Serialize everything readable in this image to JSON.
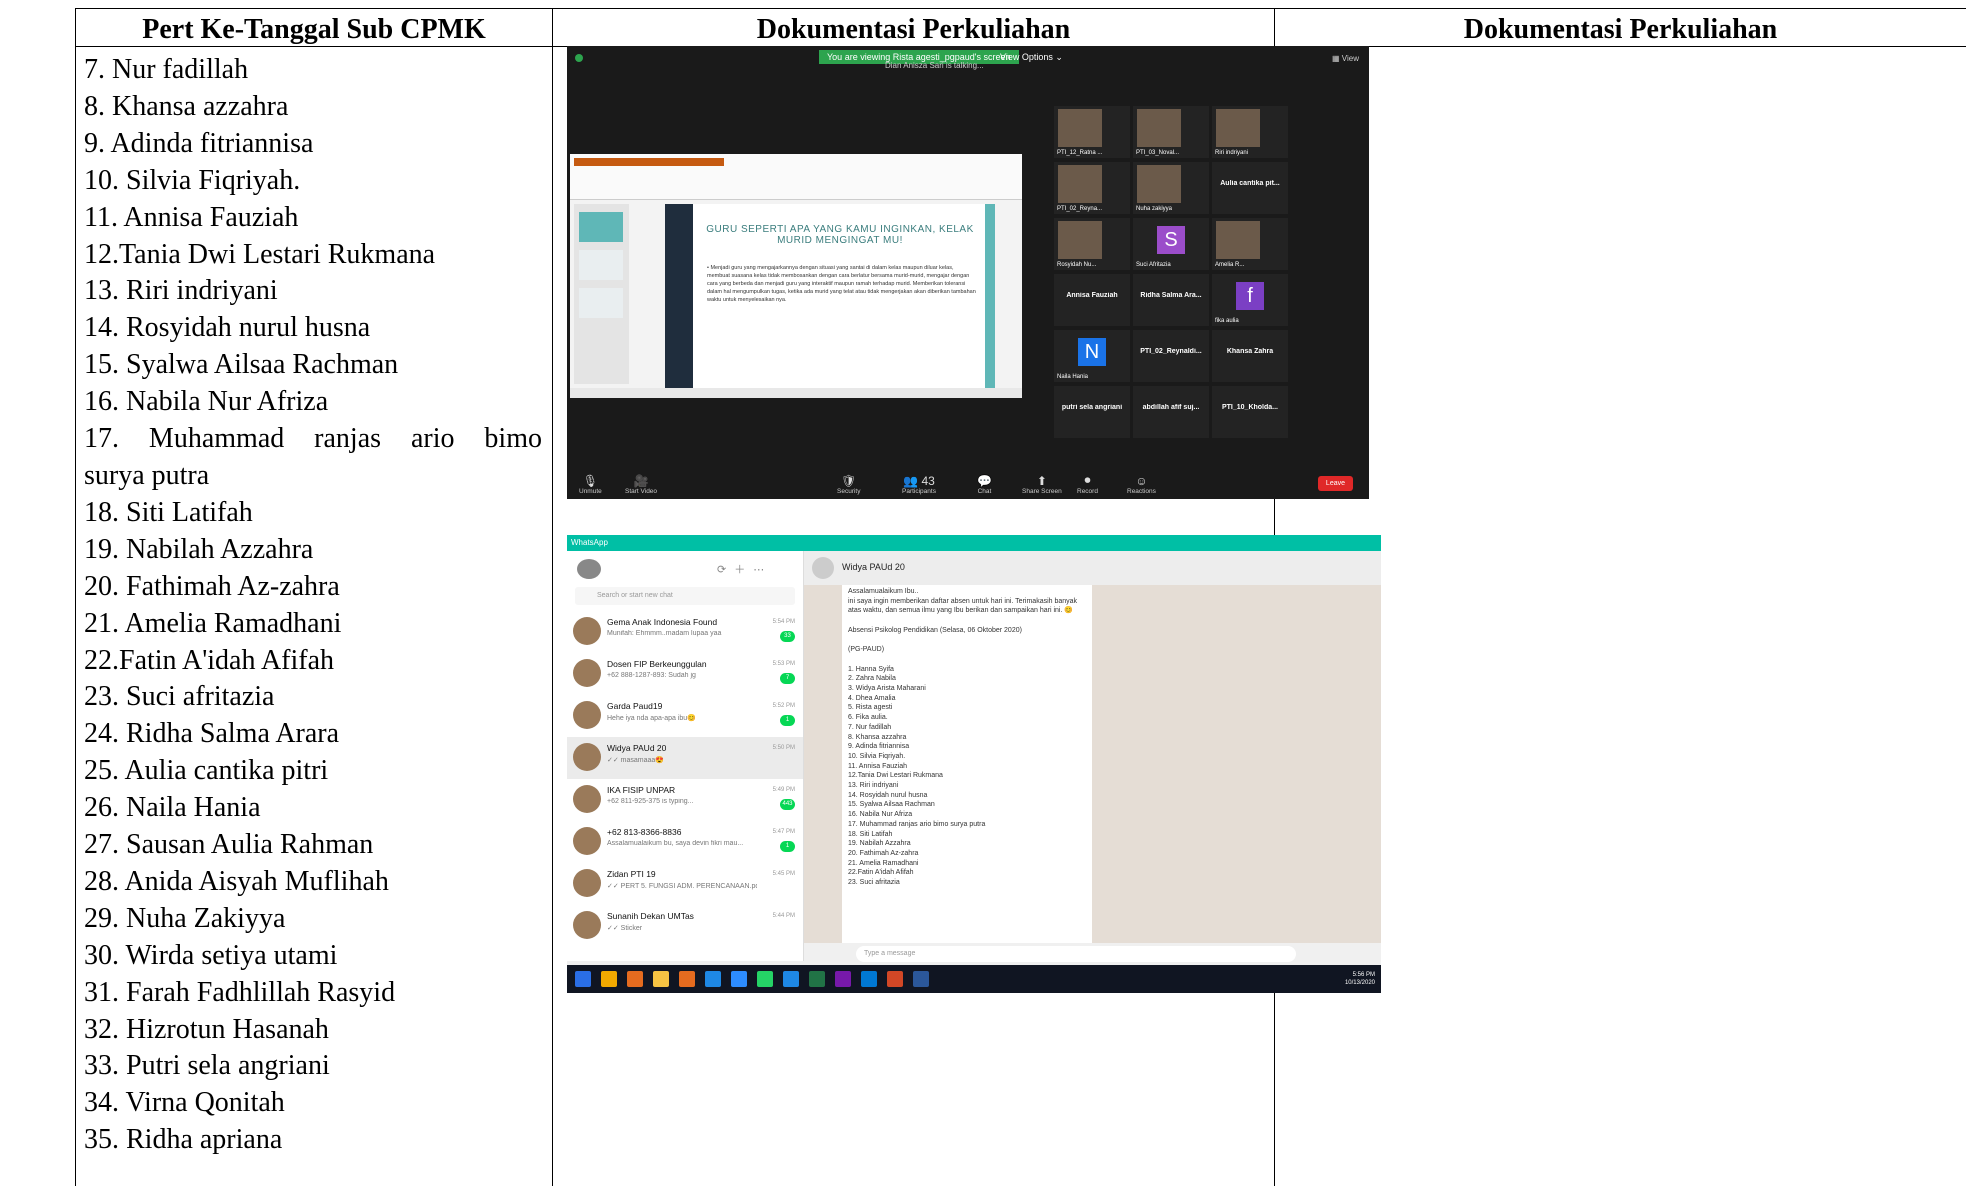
{
  "table": {
    "headers": [
      "Pert Ke-Tanggal Sub CPMK",
      "Dokumentasi Perkuliahan",
      "Dokumentasi Perkuliahan"
    ],
    "names": [
      "7. Nur fadillah",
      "8. Khansa azzahra",
      "9. Adinda fitriannisa",
      "10. Silvia Fiqriyah.",
      "11. Annisa Fauziah",
      "12.Tania Dwi Lestari Rukmana",
      "13. Riri indriyani",
      "14. Rosyidah nurul husna",
      "15. Syalwa Ailsaa Rachman",
      "16. Nabila Nur Afriza",
      "17. Muhammad ranjas ario bimo",
      "surya putra",
      "18. Siti Latifah",
      "19. Nabilah Azzahra",
      "20. Fathimah Az-zahra",
      "21. Amelia Ramadhani",
      "22.Fatin A'idah Afifah",
      "23. Suci afritazia",
      "24. Ridha Salma Arara",
      "25. Aulia cantika pitri",
      "26. Naila Hania",
      "27. Sausan Aulia Rahman",
      "28. Anida Aisyah Muflihah",
      "29. Nuha Zakiyya",
      "30. Wirda setiya utami",
      "31. Farah Fadhlillah Rasyid",
      "32. Hizrotun Hasanah",
      "33. Putri sela angriani",
      "34. Virna Qonitah",
      "35. Ridha apriana"
    ]
  },
  "zoom": {
    "banner": "You are viewing Rista agesti_pgpaud's screen",
    "view_options": "View Options ⌄",
    "subtitle": "Dian Anisza Sari is talking...",
    "gallery_view": "▦ View",
    "slide_title": "GURU SEPERTI APA YANG KAMU INGINKAN, KELAK MURID MENGINGAT MU!",
    "slide_body": "• Menjadi guru yang mengajarkannya dengan situasi yang santai di dalam kelas maupun diluar kelas, membuat suasana kelas tidak membosankan dengan cara berlatur bersama murid-murid, mengajar dengan cara yang berbeda dan menjadi guru yang interaktif maupun ramah terhadap murid. Memberikan toleransi dalam hal mengumpulkan tugas, ketika ada murid yang telat atau tidak mengerjakan akan diberikan tambahan waktu untuk menyelesaikan nya.",
    "tiles": [
      {
        "name": "PTI_12_Ratna ...",
        "type": "photo"
      },
      {
        "name": "PTI_03_Noval...",
        "type": "photo"
      },
      {
        "name": "Riri indriyani",
        "type": "photo"
      },
      {
        "name": "PTI_02_Reyna...",
        "type": "photo"
      },
      {
        "name": "Nuha zakiyya",
        "type": "photo"
      },
      {
        "name": "Aulia cantika pit...",
        "type": "text"
      },
      {
        "name": "Rosyidah Nu...",
        "type": "photo"
      },
      {
        "name": "Suci Afritazia",
        "type": "letter",
        "letter": "S",
        "color": "#9b4dca"
      },
      {
        "name": "Amelia R...",
        "type": "photo"
      },
      {
        "name": "Annisa Fauziah",
        "type": "text"
      },
      {
        "name": "Ridha Salma Ara...",
        "type": "text"
      },
      {
        "name": "fika aulia",
        "type": "letter",
        "letter": "f",
        "color": "#7b3fc4"
      },
      {
        "name": "Naila Hania",
        "type": "letter",
        "letter": "N",
        "color": "#1a73e8"
      },
      {
        "name": "PTI_02_Reynaldi...",
        "type": "text"
      },
      {
        "name": "Khansa Zahra",
        "type": "text"
      },
      {
        "name": "putri sela angriani",
        "type": "text"
      },
      {
        "name": "abdillah afif suj...",
        "type": "text"
      },
      {
        "name": "PTI_10_Kholda...",
        "type": "text"
      }
    ],
    "toolbar": [
      {
        "icon": "🎙",
        "label": "Unmute"
      },
      {
        "icon": "🎥",
        "label": "Start Video"
      },
      {
        "icon": "🛡",
        "label": "Security"
      },
      {
        "icon": "👥 43",
        "label": "Participants"
      },
      {
        "icon": "💬",
        "label": "Chat"
      },
      {
        "icon": "⬆",
        "label": "Share Screen"
      },
      {
        "icon": "⏺",
        "label": "Record"
      },
      {
        "icon": "☺",
        "label": "Reactions"
      }
    ],
    "leave": "Leave"
  },
  "whatsapp": {
    "app_title": "WhatsApp",
    "search_placeholder": "Search or start new chat",
    "chats": [
      {
        "name": "Gema Anak Indonesia Found",
        "preview": "Munifah: Ehmmm..madam lupaa yaa",
        "time": "5:54 PM",
        "badge": "33"
      },
      {
        "name": "Dosen FIP Berkeunggulan",
        "preview": "+62 888-1287-893: Sudah jg",
        "time": "5:53 PM",
        "badge": "7"
      },
      {
        "name": "Garda Paud19",
        "preview": "Hehe iya nda apa-apa ibu😊",
        "time": "5:52 PM",
        "badge": "1"
      },
      {
        "name": "Widya PAUd 20",
        "preview": "✓✓ masamaaa😍",
        "time": "5:50 PM",
        "badge": ""
      },
      {
        "name": "IKA FISIP UNPAR",
        "preview": "+62 811-925-375 is typing...",
        "time": "5:49 PM",
        "badge": "443"
      },
      {
        "name": "+62 813-8366-8836",
        "preview": "Assalamualaikum bu, saya devin fikri mau...",
        "time": "5:47 PM",
        "badge": "1"
      },
      {
        "name": "Zidan PTI 19",
        "preview": "✓✓ PERT 5. FUNGSI ADM. PERENCANAAN.pd...",
        "time": "5:45 PM",
        "badge": ""
      },
      {
        "name": "Sunanih Dekan UMTas",
        "preview": "✓✓ Sticker",
        "time": "5:44 PM",
        "badge": ""
      }
    ],
    "active_chat": "Widya PAUd 20",
    "message_lines": [
      "Assalamualaikum Ibu..",
      "ini saya ingin memberikan daftar absen untuk hari ini. Terimakasih banyak",
      "atas waktu, dan semua ilmu yang Ibu berikan dan sampaikan hari ini. 😊",
      "",
      "Absensi Psikolog Pendidikan (Selasa, 06 Oktober 2020)",
      "",
      "(PG-PAUD)",
      "",
      "1. Hanna Syifa",
      "2. Zahra Nabila",
      "3. Widya Arista Maharani",
      "4. Dhea Amalia",
      "5. Rista agesti",
      "6. Fika aulia.",
      "7. Nur fadillah",
      "8. Khansa azzahra",
      "9. Adinda fitriannisa",
      "10. Silvia Fiqriyah.",
      "11. Annisa Fauziah",
      "12.Tania Dwi Lestari Rukmana",
      "13. Riri indriyani",
      "14. Rosyidah nurul husna",
      "15. Syalwa Ailsaa Rachman",
      "16. Nabila Nur Afriza",
      "17. Muhammad ranjas ario bimo surya putra",
      "18. Siti Latifah",
      "19. Nabilah Azzahra",
      "20. Fathimah Az-zahra",
      "21. Amelia Ramadhani",
      "22.Fatin A'idah Afifah",
      "23. Suci afritazia"
    ],
    "compose_placeholder": "Type a message",
    "clock_time": "5:56 PM",
    "clock_date": "10/13/2020"
  }
}
